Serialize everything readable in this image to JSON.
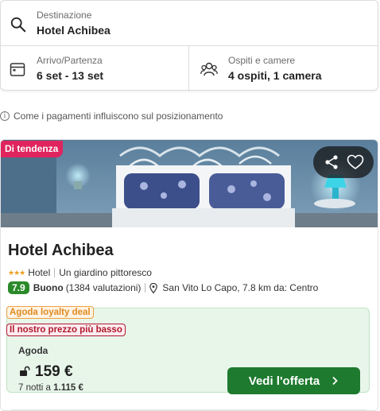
{
  "search": {
    "destination_label": "Destinazione",
    "destination_value": "Hotel Achibea",
    "dates_label": "Arrivo/Partenza",
    "dates_value": "6 set - 13 set",
    "guests_label": "Ospiti e camere",
    "guests_value": "4 ospiti, 1 camera"
  },
  "info": {
    "icon": "info-icon",
    "text": "Come i pagamenti influiscono sul posizionamento"
  },
  "hotel": {
    "badge": "Di tendenza",
    "name": "Hotel Achibea",
    "stars": 3,
    "stars_glyph": "★★★",
    "type": "Hotel",
    "highlight": "Un giardino pittoresco",
    "score": "7.9",
    "rating_word": "Buono",
    "reviews": "(1384 valutazioni)",
    "location": "San Vito Lo Capo, 7.8 km da: Centro",
    "deal": {
      "loyalty_tag": "Agoda loyalty deal",
      "price_tag": "Il nostro prezzo più basso",
      "provider": "Agoda",
      "price": "159 €",
      "nights": "7 notti a",
      "total": "1.115 €",
      "cta": "Vedi l'offerta"
    }
  },
  "colors": {
    "badge": "#e0245e",
    "score": "#2a8a2a",
    "cta": "#1e7a2e",
    "deal_bg": "#e8f6ea",
    "stars": "#f0a020"
  }
}
